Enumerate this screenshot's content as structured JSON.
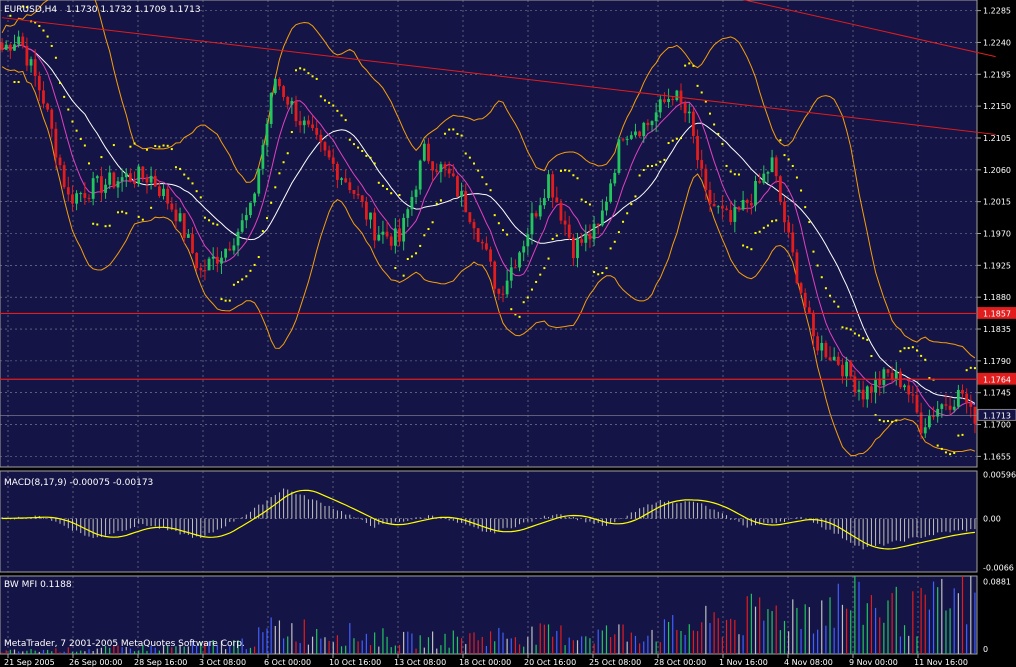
{
  "colors": {
    "background": "#000000",
    "pane": "#141446",
    "grid": "#8a8a9a",
    "frame": "#a0a0a0",
    "text": "#ffffff",
    "bull": "#22c55e",
    "bear": "#e11d1d",
    "ma_fast": "#e040c0",
    "ma_slow": "#ffffff",
    "bands": "#f59e0b",
    "sar": "#ffff00",
    "trendline": "#e11d1d",
    "hline": "#e11d1d",
    "macd_hist": "#c0c0c0",
    "macd_signal": "#ffff00",
    "price_label_bg": "#e11d1d",
    "current_label_bg": "#141446"
  },
  "header": {
    "symbol_tf": "EURUSD,H4",
    "ohlc": "1.1730 1.1732 1.1709 1.1713"
  },
  "macd_pane": {
    "title": "MACD(8,17,9) -0.00075 -0.00173"
  },
  "mfi_pane": {
    "title": "BW MFI 0.1188"
  },
  "copyright": "MetaTrader, 7 2001-2005 MetaQuotes Software Corp.",
  "chart_data": {
    "type": "candlestick",
    "symbol": "EURUSD",
    "timeframe": "H4",
    "price_axis_ticks": [
      "1.2285",
      "1.2240",
      "1.2195",
      "1.2150",
      "1.2105",
      "1.2060",
      "1.2015",
      "1.1970",
      "1.1925",
      "1.1880",
      "1.1835",
      "1.1790",
      "1.1745",
      "1.1700",
      "1.1655"
    ],
    "ylim": [
      1.164,
      1.23
    ],
    "price_labels": [
      {
        "value": 1.1857,
        "text": "1.1857",
        "style": "red"
      },
      {
        "value": 1.1764,
        "text": "1.1764",
        "style": "red"
      },
      {
        "value": 1.1713,
        "text": "1.1713",
        "style": "current"
      }
    ],
    "time_labels": [
      "21 Sep 2005",
      "26 Sep 00:00",
      "28 Sep 16:00",
      "3 Oct 08:00",
      "6 Oct 00:00",
      "10 Oct 16:00",
      "13 Oct 08:00",
      "18 Oct 00:00",
      "20 Oct 16:00",
      "25 Oct 08:00",
      "28 Oct 00:00",
      "1 Nov 16:00",
      "4 Nov 08:00",
      "9 Nov 00:00",
      "11 Nov 16:00"
    ],
    "trendlines": [
      {
        "from": [
          0,
          1.2275
        ],
        "to": [
          240,
          1.211
        ]
      },
      {
        "from": [
          168,
          1.2315
        ],
        "to": [
          240,
          1.222
        ]
      }
    ],
    "macd_axis_ticks": [
      "0.00596",
      "0.00",
      "-0.0066"
    ],
    "macd_ylim": [
      -0.0072,
      0.0064
    ],
    "mfi_axis_ticks": [
      "0.0881",
      "0"
    ],
    "mfi_ylim": [
      0,
      0.095
    ],
    "price_waypoints": [
      [
        0,
        1.223
      ],
      [
        4,
        1.225
      ],
      [
        10,
        1.216
      ],
      [
        16,
        1.202
      ],
      [
        22,
        1.2035
      ],
      [
        30,
        1.205
      ],
      [
        36,
        1.205
      ],
      [
        42,
        1.2
      ],
      [
        48,
        1.1915
      ],
      [
        54,
        1.195
      ],
      [
        60,
        1.2
      ],
      [
        66,
        1.219
      ],
      [
        72,
        1.213
      ],
      [
        78,
        1.208
      ],
      [
        84,
        1.204
      ],
      [
        90,
        1.1975
      ],
      [
        96,
        1.196
      ],
      [
        102,
        1.2085
      ],
      [
        108,
        1.205
      ],
      [
        114,
        1.199
      ],
      [
        120,
        1.1885
      ],
      [
        126,
        1.196
      ],
      [
        132,
        1.205
      ],
      [
        138,
        1.195
      ],
      [
        144,
        1.1975
      ],
      [
        150,
        1.2115
      ],
      [
        156,
        1.2125
      ],
      [
        162,
        1.217
      ],
      [
        166,
        1.213
      ],
      [
        170,
        1.202
      ],
      [
        176,
        1.1985
      ],
      [
        182,
        1.203
      ],
      [
        186,
        1.207
      ],
      [
        190,
        1.196
      ],
      [
        196,
        1.182
      ],
      [
        202,
        1.179
      ],
      [
        208,
        1.1745
      ],
      [
        214,
        1.177
      ],
      [
        218,
        1.176
      ],
      [
        222,
        1.17
      ],
      [
        226,
        1.1725
      ],
      [
        232,
        1.1745
      ],
      [
        234,
        1.1713
      ]
    ],
    "macd_waypoints": [
      [
        0,
        0.0
      ],
      [
        10,
        0.0003
      ],
      [
        22,
        -0.003
      ],
      [
        34,
        -0.0008
      ],
      [
        48,
        -0.003
      ],
      [
        60,
        0.001
      ],
      [
        68,
        0.0045
      ],
      [
        80,
        0.0016
      ],
      [
        90,
        -0.0012
      ],
      [
        104,
        0.0005
      ],
      [
        118,
        -0.0022
      ],
      [
        134,
        0.0008
      ],
      [
        146,
        -0.0012
      ],
      [
        158,
        0.0026
      ],
      [
        168,
        0.0024
      ],
      [
        180,
        -0.0012
      ],
      [
        194,
        0.0002
      ],
      [
        208,
        -0.0045
      ],
      [
        220,
        -0.003
      ],
      [
        228,
        -0.002
      ],
      [
        234,
        -0.0017
      ]
    ],
    "mfi_waypoints": [
      [
        0,
        0.004
      ],
      [
        40,
        0.01
      ],
      [
        60,
        0.018
      ],
      [
        66,
        0.04
      ],
      [
        100,
        0.02
      ],
      [
        120,
        0.028
      ],
      [
        140,
        0.03
      ],
      [
        160,
        0.035
      ],
      [
        184,
        0.06
      ],
      [
        196,
        0.07
      ],
      [
        208,
        0.08
      ],
      [
        220,
        0.06
      ],
      [
        234,
        0.0881
      ]
    ]
  }
}
